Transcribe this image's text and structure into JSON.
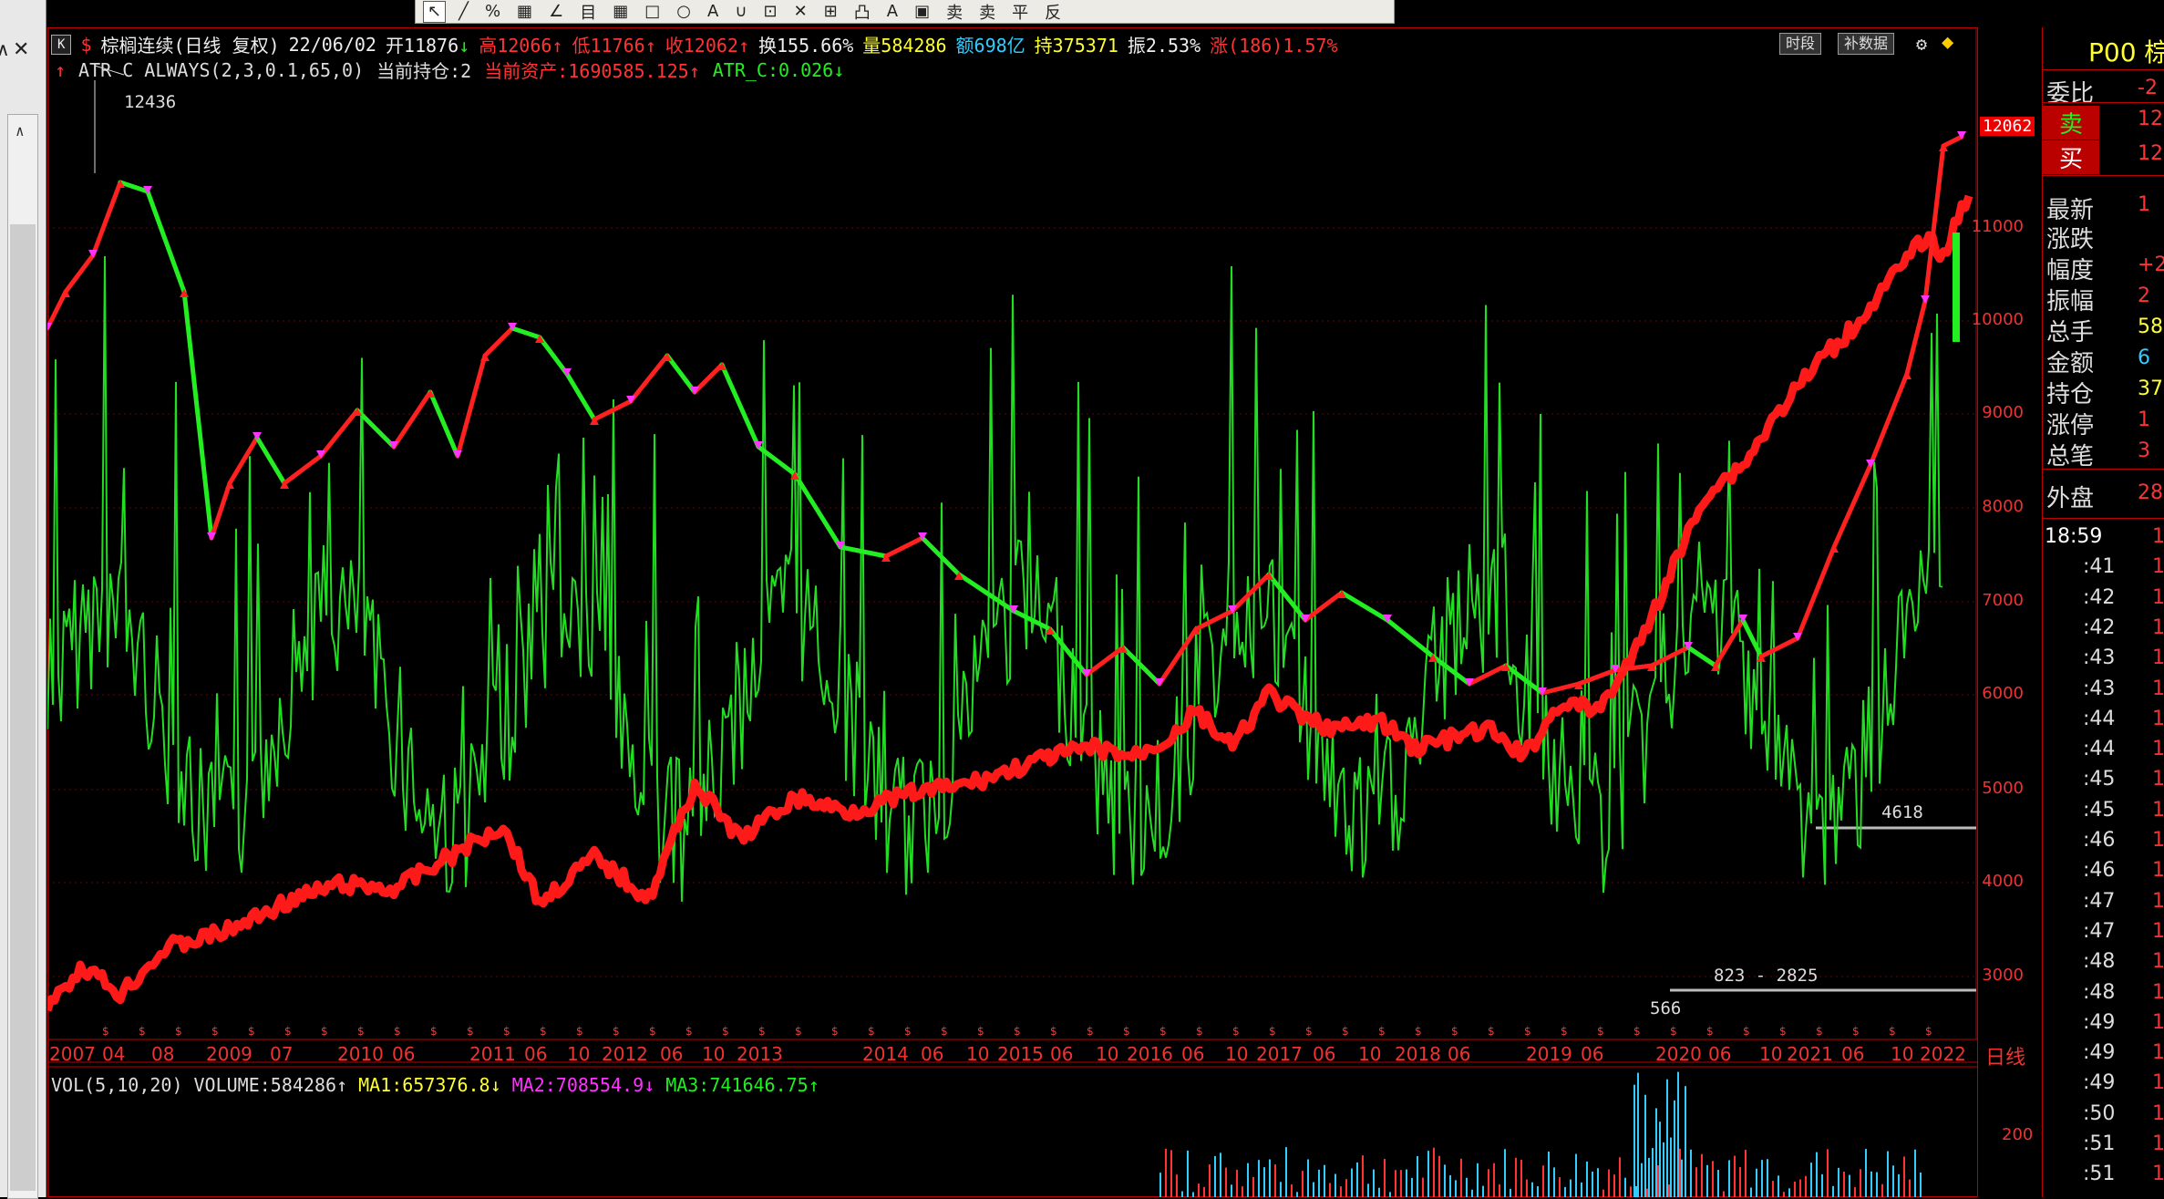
{
  "toolbar": {
    "items": [
      "↖",
      "╱",
      "%",
      "▦",
      "∠",
      "目",
      "▦",
      "□",
      "○",
      "A",
      "∪",
      "⊡",
      "✕",
      "⊞",
      "凸",
      "A",
      "▣",
      "卖",
      "卖",
      "平",
      "反"
    ]
  },
  "sidebar": {
    "a_label": "∧",
    "close_label": "✕",
    "scroll_up": "∧"
  },
  "info": {
    "kbtn": "K",
    "name": "棕榈连续(日线 复权)",
    "date": "22/06/02",
    "open": "开11876",
    "open_arrow": "↓",
    "high": "高12066",
    "high_arrow": "↑",
    "low": "低11766",
    "low_arrow": "↑",
    "close": "收12062",
    "close_arrow": "↑",
    "turnover": "换155.66%",
    "volume": "量584286",
    "amount": "额698亿",
    "oi": "持375371",
    "amp": "振2.53%",
    "chg": "涨(186)1.57%"
  },
  "indicator": {
    "arrow": "↑",
    "name": "ATR C ALWAYS(2,3,0.1,65,0)",
    "pos": "当前持仓:2",
    "asset": "当前资产:1690585.125",
    "asset_arrow": "↑",
    "atrc": "ATR_C:0.026",
    "atrc_arrow": "↓"
  },
  "buttons": {
    "period": "时段",
    "fill": "补数据",
    "daily": "日线"
  },
  "annotations": {
    "peak": "12436",
    "last": "12062",
    "level1": "4618",
    "range": "823 - 2825",
    "low": "566"
  },
  "yaxis": [
    "11000",
    "10000",
    "9000",
    "8000",
    "7000",
    "6000",
    "5000",
    "4000",
    "3000"
  ],
  "xaxis": [
    "2007",
    "04",
    "08",
    "2009",
    "07",
    "2010",
    "06",
    "2011",
    "06",
    "10",
    "2012",
    "06",
    "10",
    "2013",
    "2014",
    "06",
    "10",
    "2015",
    "06",
    "10",
    "2016",
    "06",
    "10",
    "2017",
    "06",
    "10",
    "2018",
    "06",
    "2019",
    "06",
    "2020",
    "06",
    "10",
    "2021",
    "06",
    "10",
    "2022"
  ],
  "vol": {
    "label": "VOL(5,10,20)",
    "volume": "VOLUME:584286",
    "v_arrow": "↑",
    "ma1": "MA1:657376.8",
    "ma1_arrow": "↓",
    "ma2": "MA2:708554.9",
    "ma2_arrow": "↓",
    "ma3": "MA3:741646.75",
    "ma3_arrow": "↑",
    "axis": "200"
  },
  "quote": {
    "title": "P00 棕",
    "rows": [
      {
        "label": "委比",
        "value": "-2"
      },
      {
        "label": "卖",
        "value": "12"
      },
      {
        "label": "买",
        "value": "12"
      },
      {
        "label": "最新",
        "value": "1"
      },
      {
        "label": "涨跌",
        "value": ""
      },
      {
        "label": "幅度",
        "value": "+2"
      },
      {
        "label": "振幅",
        "value": "2"
      },
      {
        "label": "总手",
        "value": "58"
      },
      {
        "label": "金额",
        "value": "6"
      },
      {
        "label": "持仓",
        "value": "37"
      },
      {
        "label": "涨停",
        "value": "1"
      },
      {
        "label": "总笔",
        "value": "3"
      },
      {
        "label": "外盘",
        "value": "28"
      }
    ],
    "ticks": [
      "18:59",
      ":41",
      ":42",
      ":42",
      ":43",
      ":43",
      ":44",
      ":44",
      ":45",
      ":45",
      ":46",
      ":46",
      ":47",
      ":47",
      ":48",
      ":48",
      ":49",
      ":49",
      ":49",
      ":50",
      ":51",
      ":51"
    ]
  },
  "colors": {
    "red": "#ff2020",
    "green": "#22ee22",
    "grid": "#8b0000",
    "yellow": "#ffff33",
    "cyan": "#33ccff",
    "magenta": "#ff33ff"
  }
}
